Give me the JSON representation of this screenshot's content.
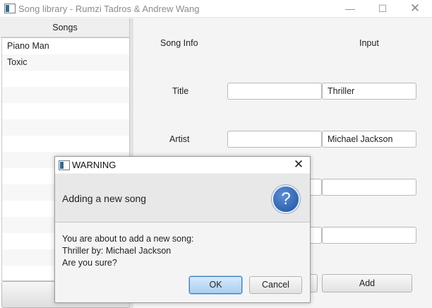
{
  "window": {
    "title": "Song library - Rumzi Tadros & Andrew Wang"
  },
  "songs_panel": {
    "header": "Songs",
    "items": [
      {
        "label": "Piano Man"
      },
      {
        "label": "Toxic"
      }
    ]
  },
  "form": {
    "col_song_info": "Song Info",
    "col_input": "Input",
    "title_label": "Title",
    "artist_label": "Artist",
    "title_input_value": "Thriller",
    "artist_input_value": "Michael Jackson",
    "add_button": "Add"
  },
  "dialog": {
    "title": "WARNING",
    "header": "Adding a new song",
    "content": [
      "You are about to add a new song:",
      "Thriller by: Michael Jackson",
      "Are you sure?"
    ],
    "ok_label": "OK",
    "cancel_label": "Cancel",
    "help_glyph": "?"
  },
  "icons": {
    "app": "app-window-icon",
    "minimize": "minimize-icon",
    "maximize": "maximize-icon",
    "close": "close-icon",
    "help": "question-icon"
  }
}
